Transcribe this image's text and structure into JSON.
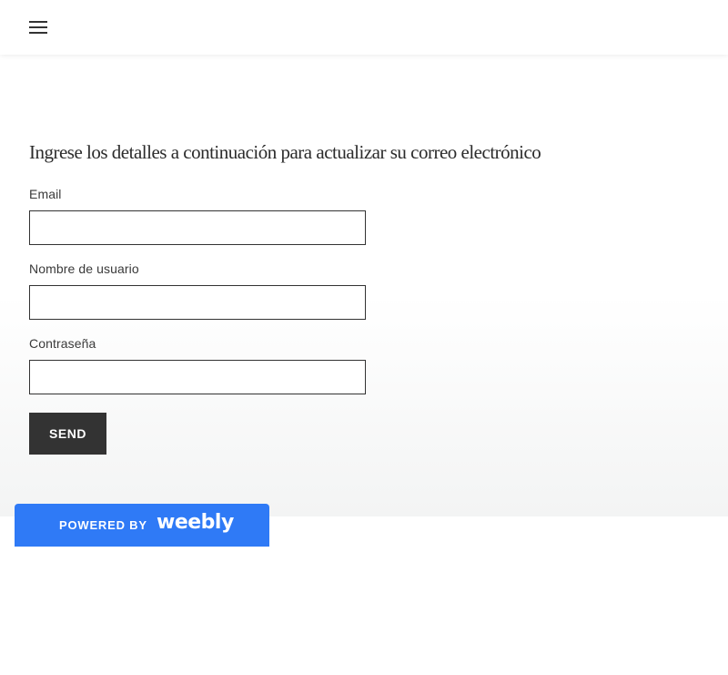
{
  "header": {
    "menu_icon": "hamburger-menu-icon"
  },
  "form": {
    "title": "Ingrese los detalles a continuación para actualizar su correo electrónico",
    "fields": [
      {
        "label": "Email",
        "value": "",
        "placeholder": ""
      },
      {
        "label": "Nombre de usuario",
        "value": "",
        "placeholder": ""
      },
      {
        "label": "Contraseña",
        "value": "",
        "placeholder": ""
      }
    ],
    "submit_label": "SEND"
  },
  "badge": {
    "powered_by": "POWERED BY",
    "brand": "weebly",
    "color": "#2f7af6"
  },
  "colors": {
    "button_bg": "#333333",
    "text": "#2b2b2b"
  }
}
